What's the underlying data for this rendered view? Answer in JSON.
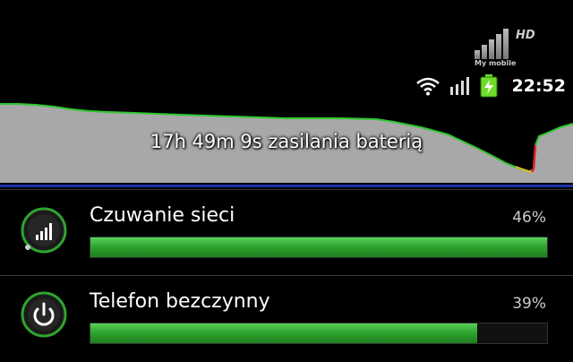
{
  "watermark": {
    "badge": "HD",
    "text": "My mobile"
  },
  "status_bar": {
    "icons": [
      "wifi-icon",
      "signal-icon",
      "battery-charging-icon"
    ],
    "time": "22:52"
  },
  "battery_graph": {
    "label": "17h 49m 9s zasilania baterią",
    "line_color": "#2ec82e",
    "fill_color": "#a8a8a8"
  },
  "usage_items": [
    {
      "name": "Czuwanie sieci",
      "percent_label": "46%",
      "percent": 46,
      "icon": "signal-bars-icon"
    },
    {
      "name": "Telefon bezczynny",
      "percent_label": "39%",
      "percent": 39,
      "icon": "power-icon"
    }
  ],
  "colors": {
    "bar_green": "#2fa42f",
    "background": "#000000"
  }
}
